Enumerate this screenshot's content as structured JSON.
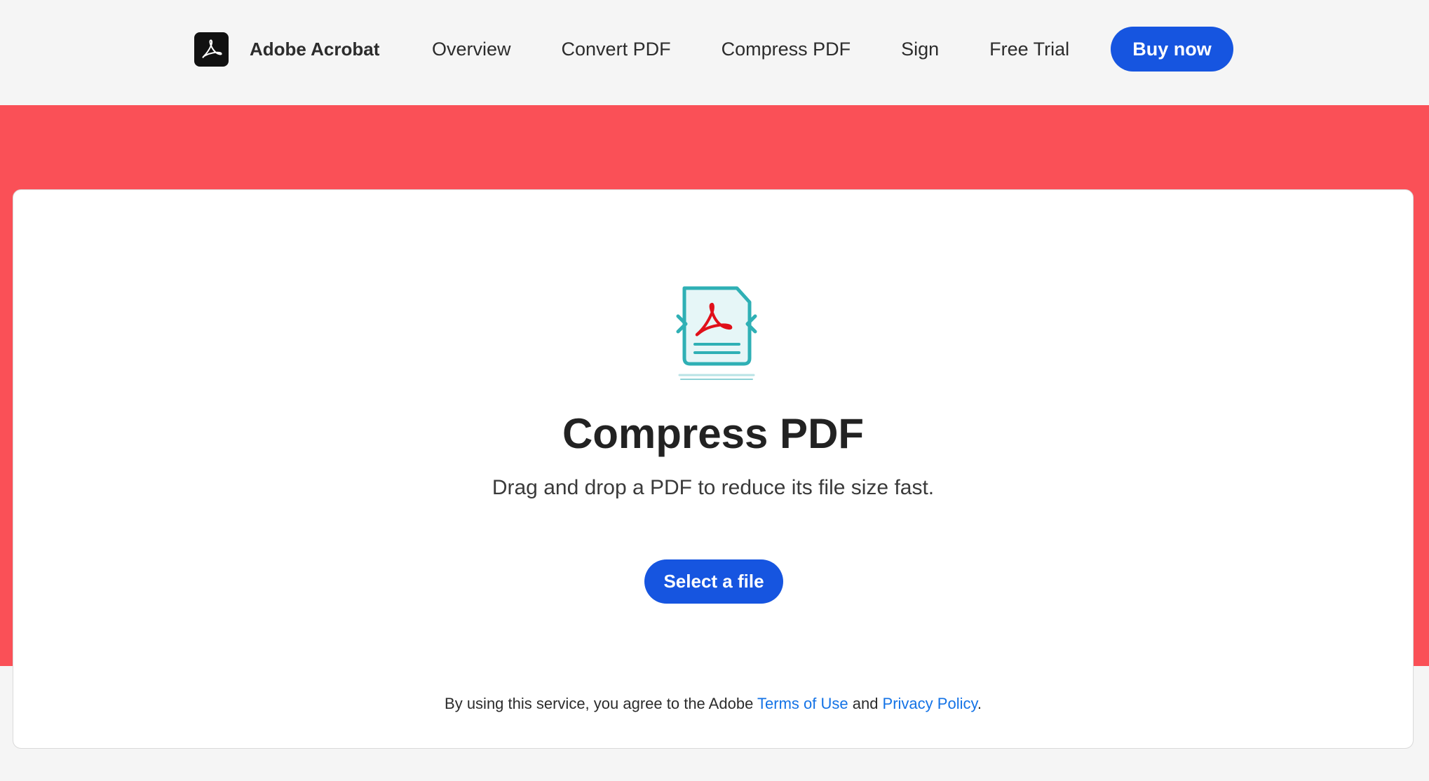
{
  "header": {
    "brand": {
      "name": "Adobe Acrobat",
      "logo_icon": "acrobat-logo-icon"
    },
    "nav": [
      {
        "label": "Overview"
      },
      {
        "label": "Convert PDF"
      },
      {
        "label": "Compress PDF"
      },
      {
        "label": "Sign"
      },
      {
        "label": "Free Trial"
      }
    ],
    "cta_label": "Buy now"
  },
  "main": {
    "icon": "compress-pdf-icon",
    "title": "Compress PDF",
    "subtitle": "Drag and drop a PDF to reduce its file size fast.",
    "select_label": "Select a file"
  },
  "legal": {
    "prefix": "By using this service, you agree to the Adobe ",
    "terms_label": "Terms of Use",
    "middle": " and ",
    "privacy_label": "Privacy Policy",
    "suffix": "."
  },
  "colors": {
    "hero_band": "#fa5057",
    "primary_button": "#1655e0",
    "link": "#1473e6",
    "icon_teal": "#2fb0b5",
    "acrobat_red": "#e0101a"
  }
}
